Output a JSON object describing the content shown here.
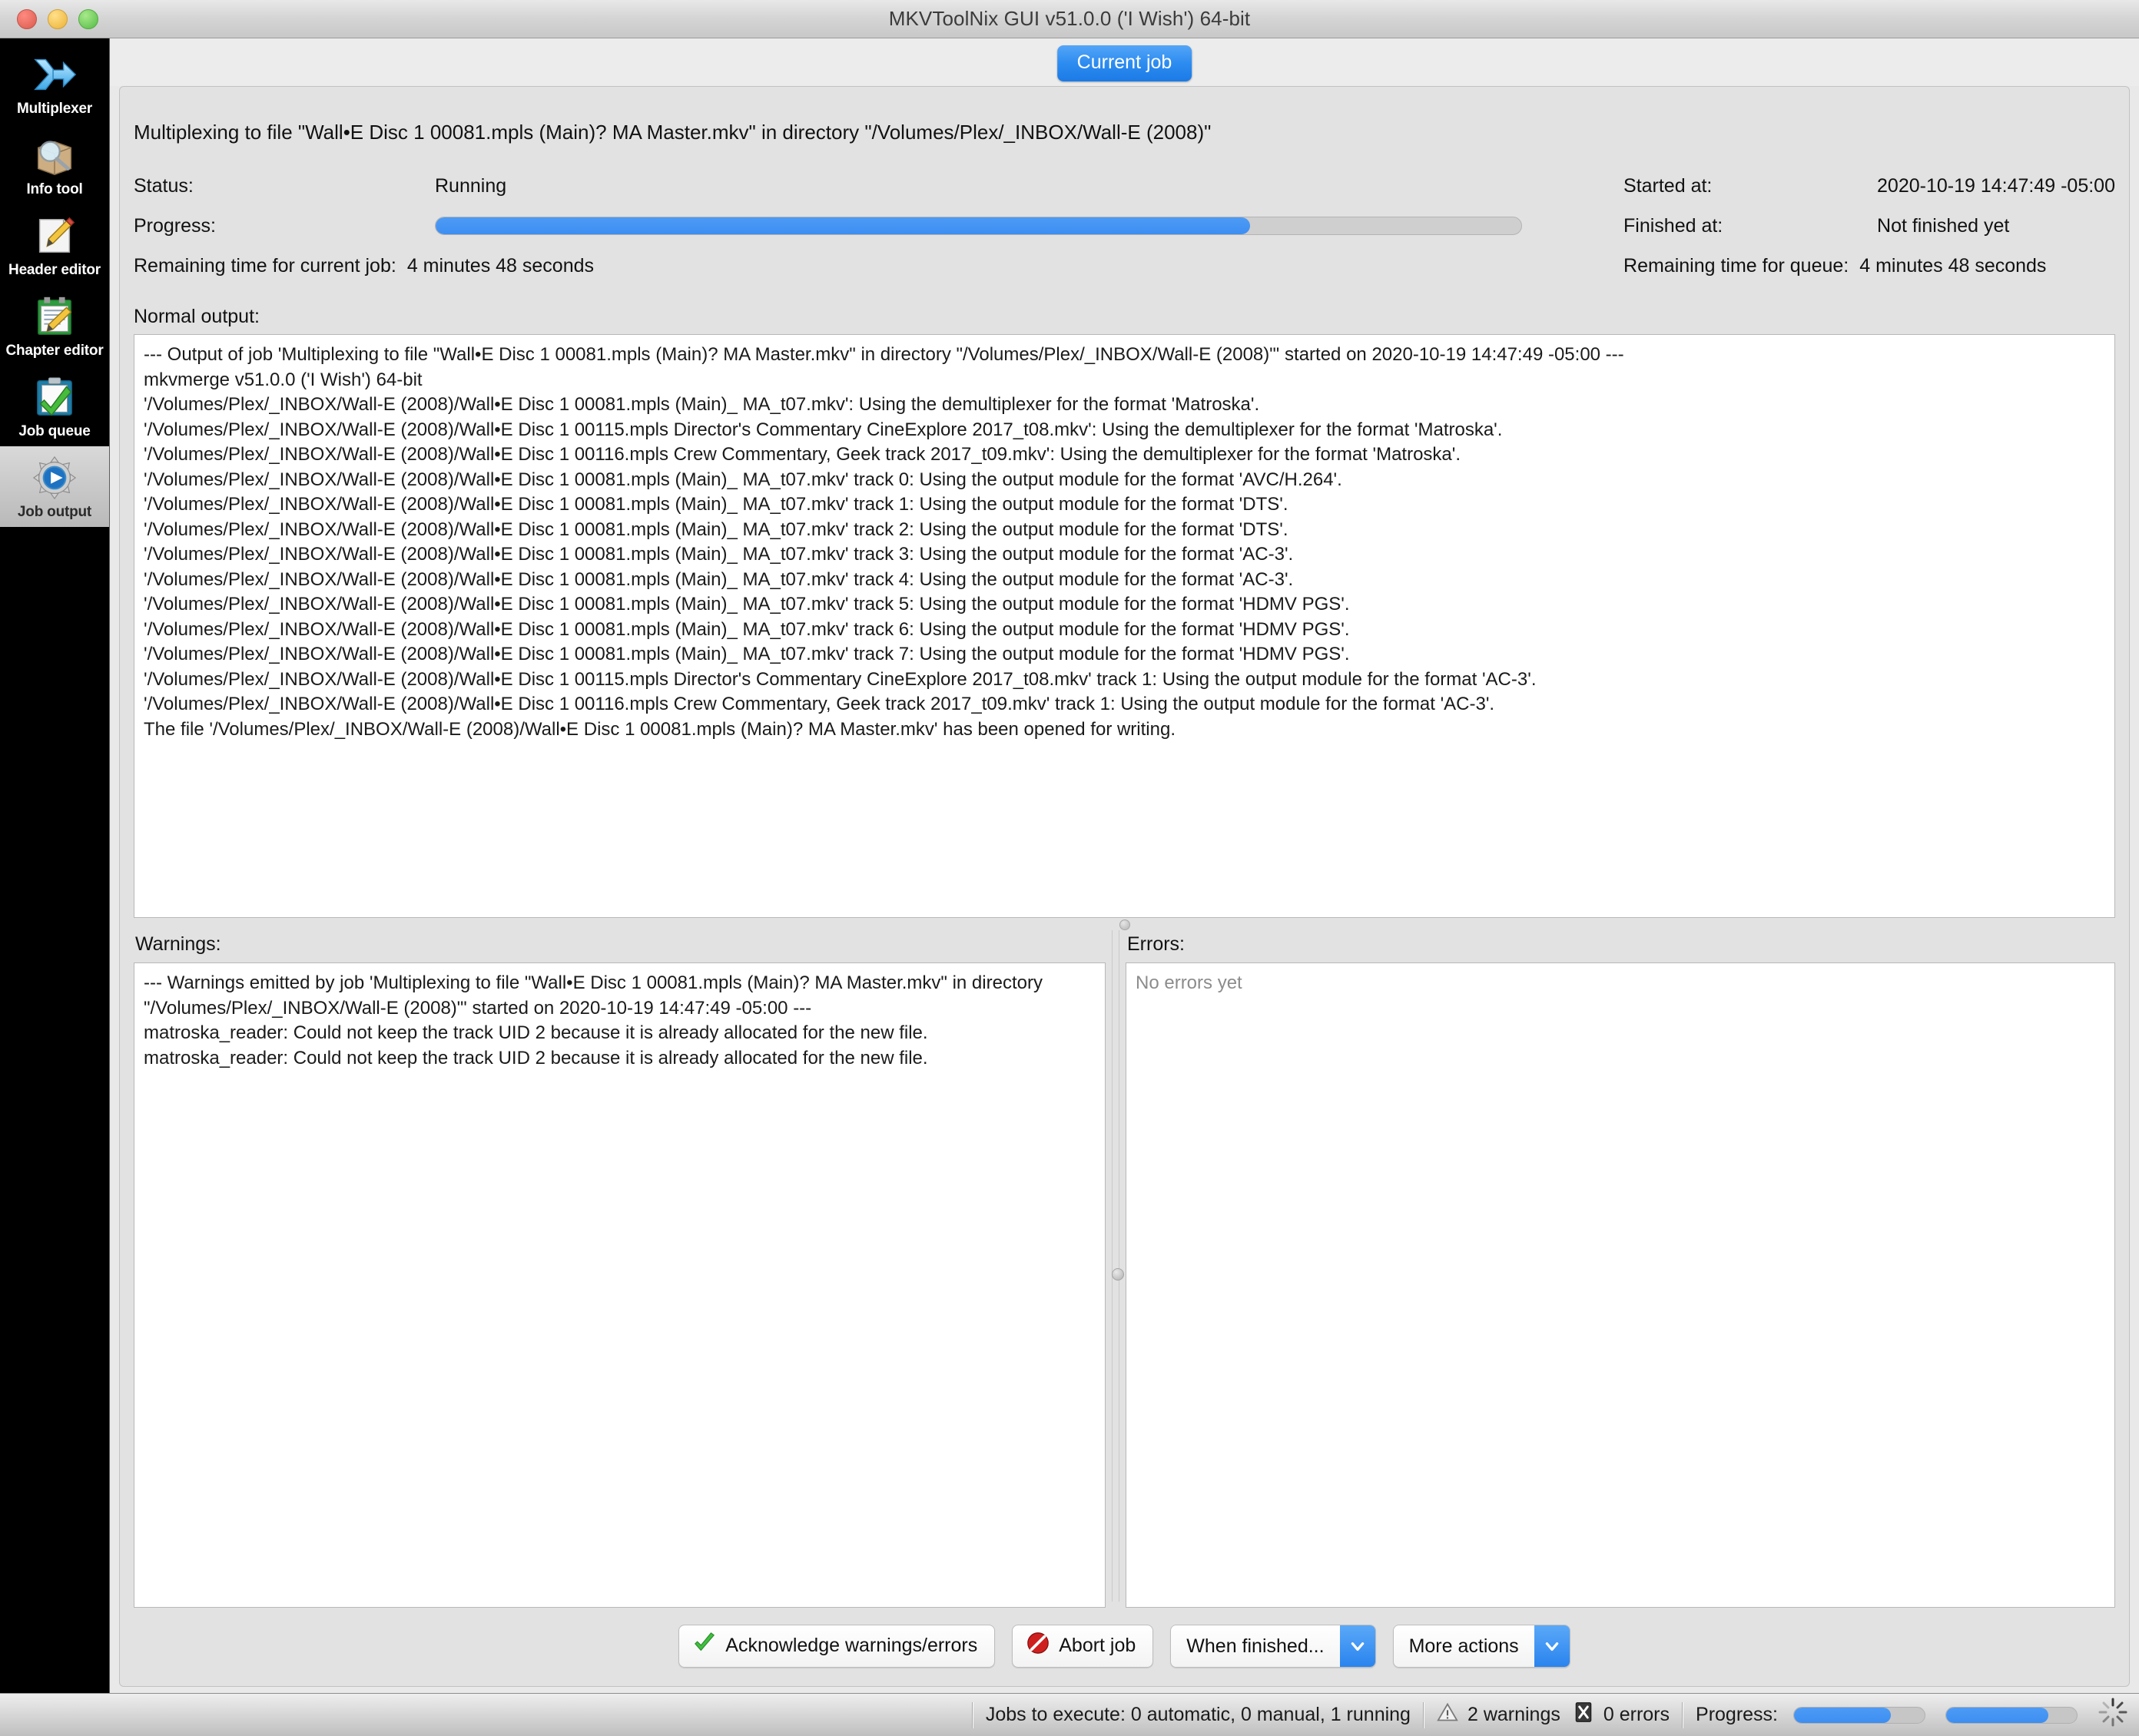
{
  "window": {
    "title": "MKVToolNix GUI v51.0.0 ('I Wish') 64-bit",
    "traffic_lights": [
      "close-button",
      "minimize-button",
      "zoom-button"
    ]
  },
  "sidebar": {
    "items": [
      {
        "label": "Multiplexer",
        "icon": "multiplexer-icon",
        "selected": false
      },
      {
        "label": "Info tool",
        "icon": "info-tool-icon",
        "selected": false
      },
      {
        "label": "Header editor",
        "icon": "header-editor-icon",
        "selected": false
      },
      {
        "label": "Chapter editor",
        "icon": "chapter-editor-icon",
        "selected": false
      },
      {
        "label": "Job queue",
        "icon": "job-queue-icon",
        "selected": false
      },
      {
        "label": "Job output",
        "icon": "job-output-icon",
        "selected": true
      }
    ]
  },
  "tabs": {
    "current_job": "Current job"
  },
  "job": {
    "headline": "Multiplexing to file \"Wall•E Disc 1 00081.mpls (Main)? MA Master.mkv\" in directory \"/Volumes/Plex/_INBOX/Wall-E (2008)\"",
    "status_label": "Status:",
    "status_value": "Running",
    "progress_label": "Progress:",
    "progress_percent": 75,
    "remaining_current_label": "Remaining time for current job:",
    "remaining_current_value": "4 minutes 48 seconds",
    "started_label": "Started at:",
    "started_value": "2020-10-19 14:47:49 -05:00",
    "finished_label": "Finished at:",
    "finished_value": "Not finished yet",
    "remaining_queue_label": "Remaining time for queue:",
    "remaining_queue_value": "4 minutes 48 seconds"
  },
  "normal_output": {
    "label": "Normal output:",
    "lines": [
      "--- Output of job 'Multiplexing to file \"Wall•E Disc 1 00081.mpls (Main)? MA Master.mkv\" in directory \"/Volumes/Plex/_INBOX/Wall-E (2008)\"' started on 2020-10-19 14:47:49 -05:00 ---",
      "mkvmerge v51.0.0 ('I Wish') 64-bit",
      "'/Volumes/Plex/_INBOX/Wall-E (2008)/Wall•E Disc 1 00081.mpls (Main)_ MA_t07.mkv': Using the demultiplexer for the format 'Matroska'.",
      "'/Volumes/Plex/_INBOX/Wall-E (2008)/Wall•E Disc 1 00115.mpls Director's Commentary CineExplore 2017_t08.mkv': Using the demultiplexer for the format 'Matroska'.",
      "'/Volumes/Plex/_INBOX/Wall-E (2008)/Wall•E Disc 1 00116.mpls Crew Commentary, Geek track 2017_t09.mkv': Using the demultiplexer for the format 'Matroska'.",
      "'/Volumes/Plex/_INBOX/Wall-E (2008)/Wall•E Disc 1 00081.mpls (Main)_ MA_t07.mkv' track 0: Using the output module for the format 'AVC/H.264'.",
      "'/Volumes/Plex/_INBOX/Wall-E (2008)/Wall•E Disc 1 00081.mpls (Main)_ MA_t07.mkv' track 1: Using the output module for the format 'DTS'.",
      "'/Volumes/Plex/_INBOX/Wall-E (2008)/Wall•E Disc 1 00081.mpls (Main)_ MA_t07.mkv' track 2: Using the output module for the format 'DTS'.",
      "'/Volumes/Plex/_INBOX/Wall-E (2008)/Wall•E Disc 1 00081.mpls (Main)_ MA_t07.mkv' track 3: Using the output module for the format 'AC-3'.",
      "'/Volumes/Plex/_INBOX/Wall-E (2008)/Wall•E Disc 1 00081.mpls (Main)_ MA_t07.mkv' track 4: Using the output module for the format 'AC-3'.",
      "'/Volumes/Plex/_INBOX/Wall-E (2008)/Wall•E Disc 1 00081.mpls (Main)_ MA_t07.mkv' track 5: Using the output module for the format 'HDMV PGS'.",
      "'/Volumes/Plex/_INBOX/Wall-E (2008)/Wall•E Disc 1 00081.mpls (Main)_ MA_t07.mkv' track 6: Using the output module for the format 'HDMV PGS'.",
      "'/Volumes/Plex/_INBOX/Wall-E (2008)/Wall•E Disc 1 00081.mpls (Main)_ MA_t07.mkv' track 7: Using the output module for the format 'HDMV PGS'.",
      "'/Volumes/Plex/_INBOX/Wall-E (2008)/Wall•E Disc 1 00115.mpls Director's Commentary CineExplore 2017_t08.mkv' track 1: Using the output module for the format 'AC-3'.",
      "'/Volumes/Plex/_INBOX/Wall-E (2008)/Wall•E Disc 1 00116.mpls Crew Commentary, Geek track 2017_t09.mkv' track 1: Using the output module for the format 'AC-3'.",
      "The file '/Volumes/Plex/_INBOX/Wall-E (2008)/Wall•E Disc 1 00081.mpls (Main)? MA Master.mkv' has been opened for writing."
    ]
  },
  "warnings": {
    "label": "Warnings:",
    "lines": [
      "--- Warnings emitted by job 'Multiplexing to file \"Wall•E Disc 1 00081.mpls (Main)? MA Master.mkv\" in directory \"/Volumes/Plex/_INBOX/Wall-E (2008)\"' started on 2020-10-19 14:47:49 -05:00 ---",
      "matroska_reader: Could not keep the track UID 2 because it is already allocated for the new file.",
      "matroska_reader: Could not keep the track UID 2 because it is already allocated for the new file."
    ]
  },
  "errors": {
    "label": "Errors:",
    "placeholder": "No errors yet"
  },
  "buttons": {
    "acknowledge": "Acknowledge warnings/errors",
    "abort": "Abort job",
    "when_finished": "When finished...",
    "more_actions": "More actions"
  },
  "statusbar": {
    "jobs_text": "Jobs to execute:  0 automatic, 0 manual, 1 running",
    "warnings_text": "2 warnings",
    "errors_text": "0 errors",
    "progress_label": "Progress:",
    "progress_1_percent": 74,
    "progress_2_percent": 78,
    "spinner": "busy-spinner-icon"
  },
  "colors": {
    "accent_blue": "#3d8ef2",
    "tab_blue": "#2d8cf0",
    "window_bg": "#e2e2e2",
    "sidebar_bg": "#000000"
  }
}
